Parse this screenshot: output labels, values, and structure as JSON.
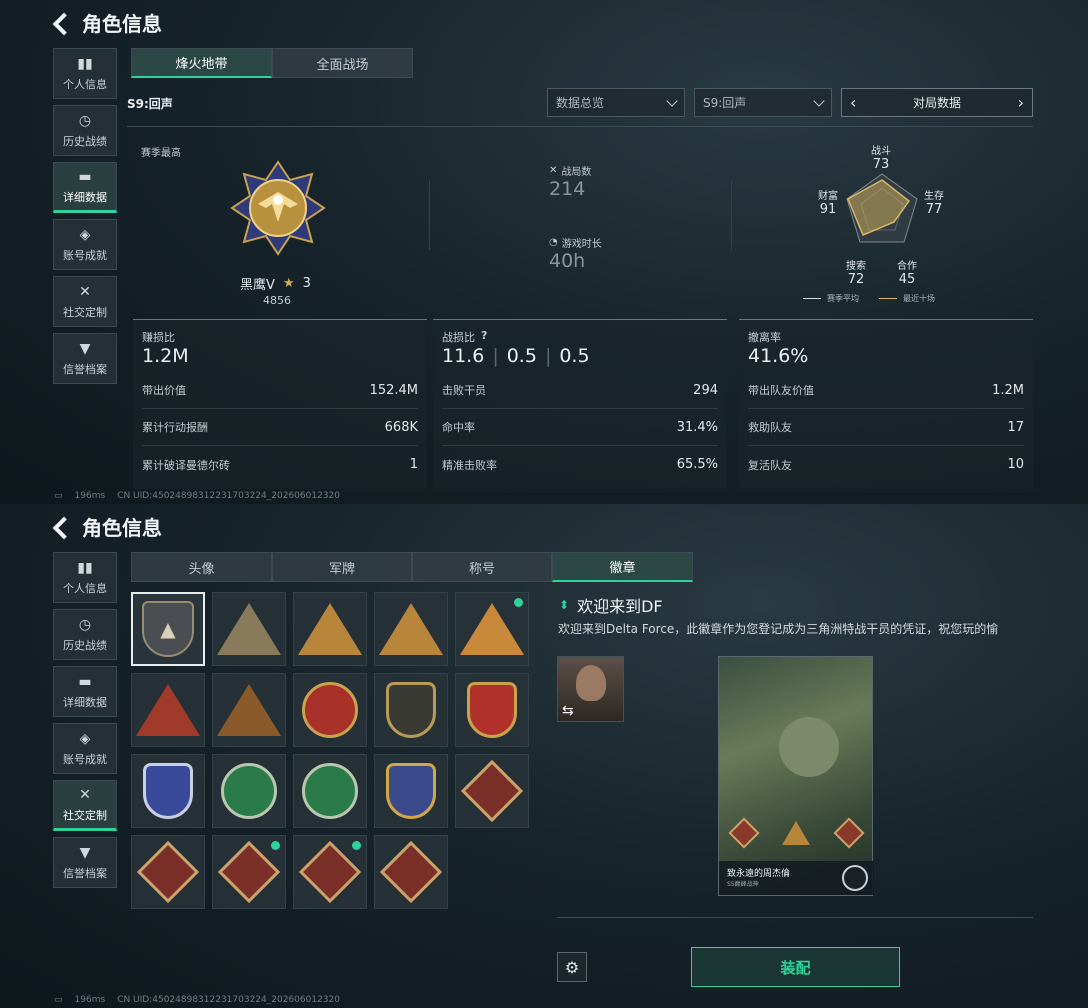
{
  "header": {
    "title": "角色信息"
  },
  "sidebar": {
    "items": [
      {
        "label": "个人信息",
        "icon": "bar-chart-icon"
      },
      {
        "label": "历史战绩",
        "icon": "clock-icon"
      },
      {
        "label": "详细数据",
        "icon": "folder-icon"
      },
      {
        "label": "账号成就",
        "icon": "medal-icon"
      },
      {
        "label": "社交定制",
        "icon": "tools-icon"
      },
      {
        "label": "信誉档案",
        "icon": "shield-icon"
      }
    ]
  },
  "panel1": {
    "tabs": [
      "烽火地带",
      "全面战场"
    ],
    "season_label": "S9:回声",
    "dropdowns": {
      "overview": "数据总览",
      "season": "S9:回声",
      "match": "对局数据"
    },
    "season_best_label": "赛季最高",
    "rank_name": "黑鹰V",
    "rank_stars": "3",
    "rank_points": "4856",
    "matches_label": "战局数",
    "matches_value": "214",
    "playtime_label": "游戏时长",
    "playtime_value": "40h",
    "radar": {
      "labels": {
        "combat": "战斗",
        "survival": "生存",
        "coop": "合作",
        "search": "搜索",
        "wealth": "财富"
      },
      "values": {
        "combat": "73",
        "survival": "77",
        "coop": "45",
        "search": "72",
        "wealth": "91"
      },
      "legend_avg": "赛季平均",
      "legend_recent": "最近十场"
    },
    "cards": [
      {
        "title": "赚损比",
        "main": "1.2M",
        "rows": [
          {
            "label": "带出价值",
            "value": "152.4M"
          },
          {
            "label": "累计行动报酬",
            "value": "668K"
          },
          {
            "label": "累计破译曼德尔砖",
            "value": "1"
          }
        ]
      },
      {
        "title": "战损比",
        "main_a": "11.6",
        "main_b": "0.5",
        "main_c": "0.5",
        "rows": [
          {
            "label": "击败干员",
            "value": "294"
          },
          {
            "label": "命中率",
            "value": "31.4%"
          },
          {
            "label": "精准击败率",
            "value": "65.5%"
          }
        ]
      },
      {
        "title": "撤离率",
        "main": "41.6%",
        "rows": [
          {
            "label": "带出队友价值",
            "value": "1.2M"
          },
          {
            "label": "救助队友",
            "value": "17"
          },
          {
            "label": "复活队友",
            "value": "10"
          }
        ]
      }
    ]
  },
  "panel2": {
    "tabs": [
      "头像",
      "军牌",
      "称号",
      "徽章"
    ],
    "badge_title": "欢迎来到DF",
    "badge_desc": "欢迎来到Delta Force，此徽章作为您登记成为三角洲特战干员的凭证，祝您玩的愉",
    "card_name": "致永遠的周杰倫",
    "card_sub": "S5巅峰战神",
    "equip_label": "装配"
  },
  "footer": {
    "ping": "196ms",
    "uid": "CN UID:450248983122317032​24_202606012320"
  }
}
